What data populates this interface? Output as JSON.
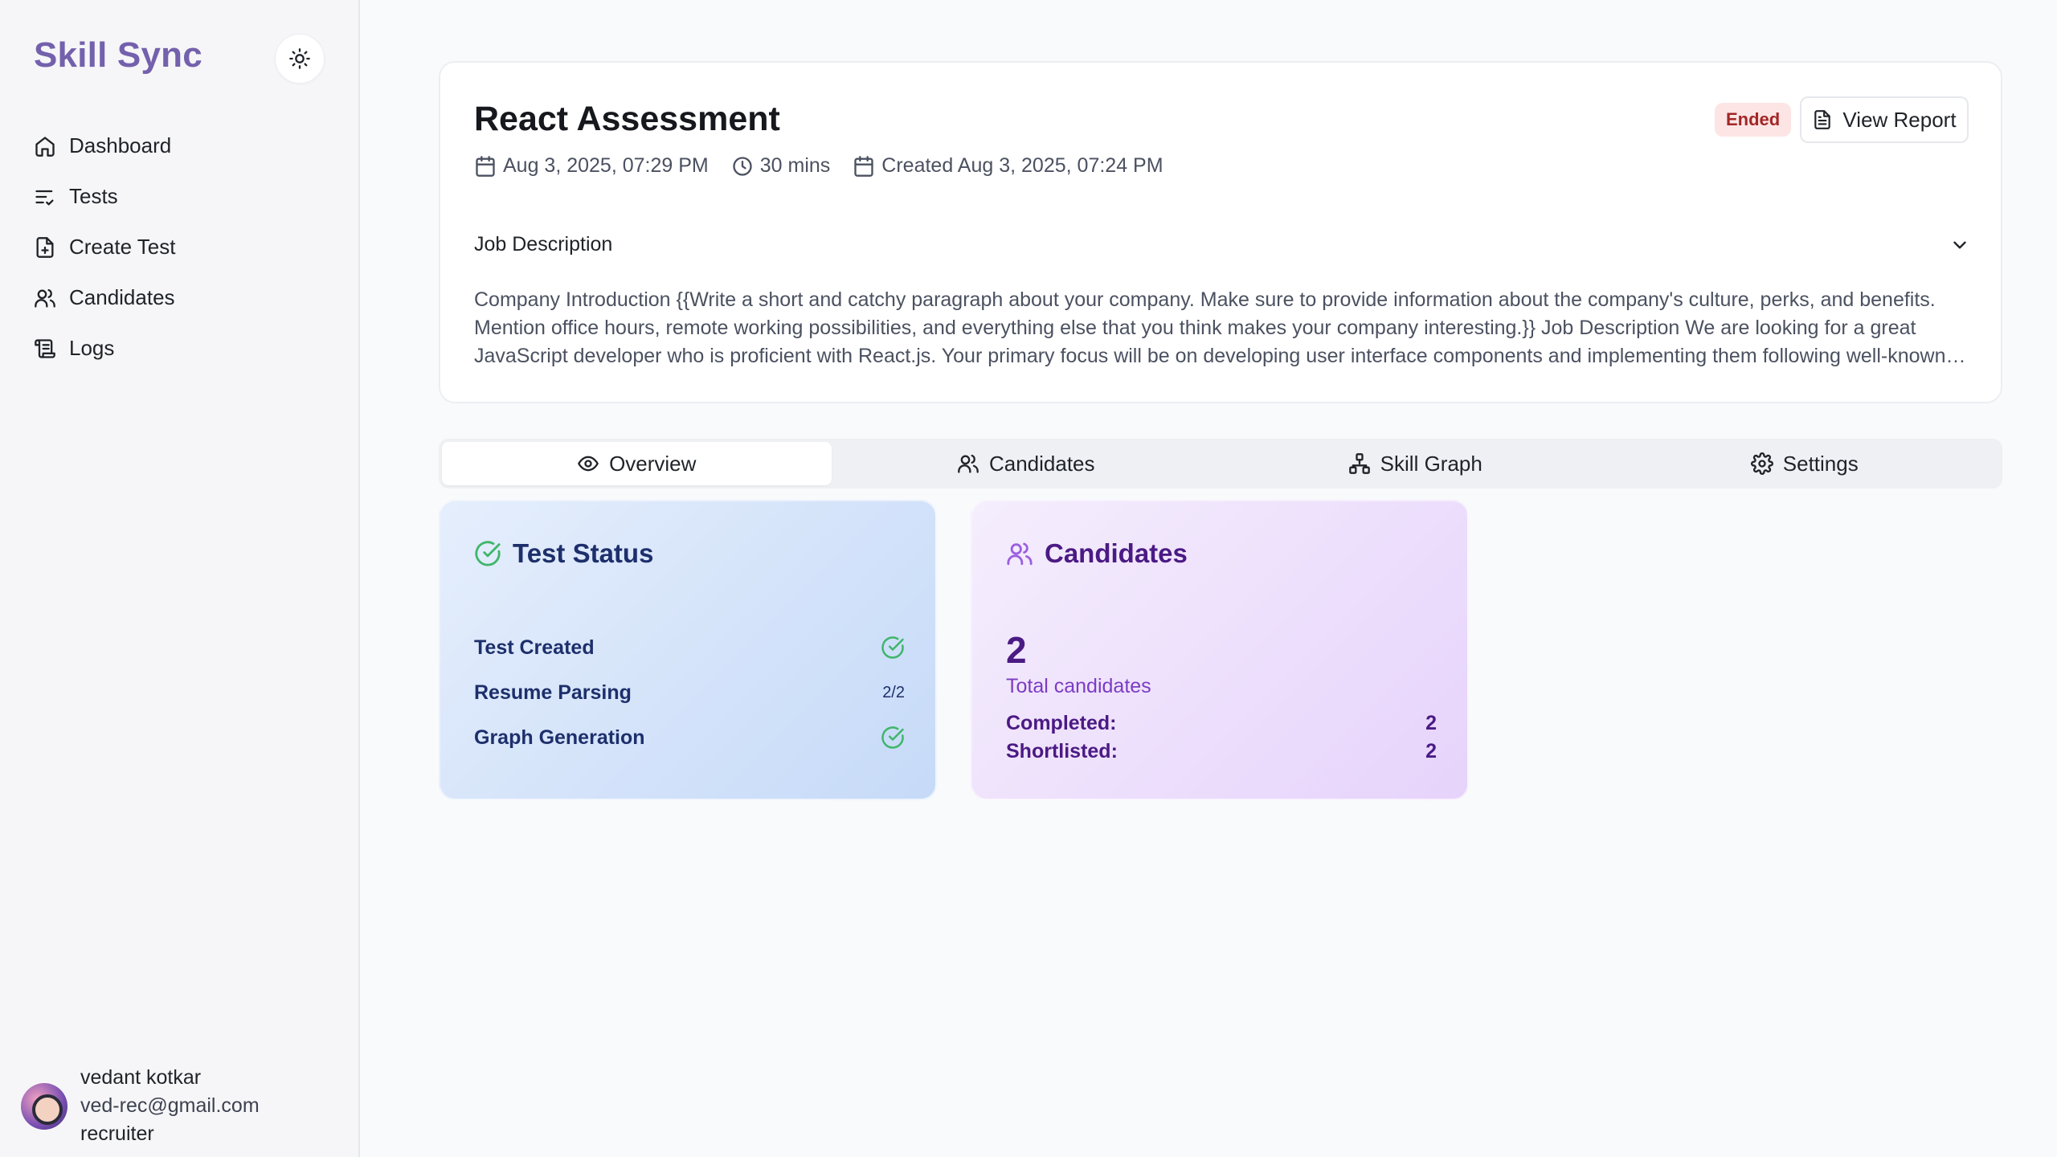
{
  "sidebar": {
    "brand": "Skill Sync",
    "theme_icon": "sun-icon",
    "nav": [
      {
        "label": "Dashboard",
        "icon": "home-icon"
      },
      {
        "label": "Tests",
        "icon": "list-check-icon"
      },
      {
        "label": "Create Test",
        "icon": "file-plus-icon"
      },
      {
        "label": "Candidates",
        "icon": "users-icon"
      },
      {
        "label": "Logs",
        "icon": "scroll-icon"
      }
    ],
    "user": {
      "name": "vedant kotkar",
      "email": "ved-rec@gmail.com",
      "role": "recruiter"
    }
  },
  "header": {
    "title": "React Assessment",
    "scheduled": "Aug 3, 2025, 07:29 PM",
    "duration": "30 mins",
    "created": "Created Aug 3, 2025, 07:24 PM",
    "status_badge": "Ended",
    "status_color": "#a32626",
    "report_label": "View Report",
    "jd_label": "Job Description",
    "jd_text": "Company Introduction {{Write a short and catchy paragraph about your company. Make sure to provide information about the company's culture, perks, and benefits. Mention office hours, remote working possibilities, and everything else that you think makes your company interesting.}} Job Description We are looking for a great JavaScript developer who is proficient with React.js. Your primary focus will be on developing user interface components and implementing them following well-known React.js workflows."
  },
  "tabs": [
    {
      "label": "Overview",
      "icon": "eye-icon",
      "active": true
    },
    {
      "label": "Candidates",
      "icon": "users-icon",
      "active": false
    },
    {
      "label": "Skill Graph",
      "icon": "network-icon",
      "active": false
    },
    {
      "label": "Settings",
      "icon": "gear-icon",
      "active": false
    }
  ],
  "test_status": {
    "title": "Test Status",
    "rows": [
      {
        "label": "Test Created",
        "value": "done"
      },
      {
        "label": "Resume Parsing",
        "value": "2/2"
      },
      {
        "label": "Graph Generation",
        "value": "done"
      }
    ],
    "check_color": "#3fb66b"
  },
  "candidates_card": {
    "title": "Candidates",
    "total": "2",
    "total_label": "Total candidates",
    "completed_label": "Completed:",
    "completed": "2",
    "shortlisted_label": "Shortlisted:",
    "shortlisted": "2"
  },
  "colors": {
    "brand": "#7461ad",
    "status_card": "#c6daf8",
    "candidates_card": "#e6d3fb"
  }
}
